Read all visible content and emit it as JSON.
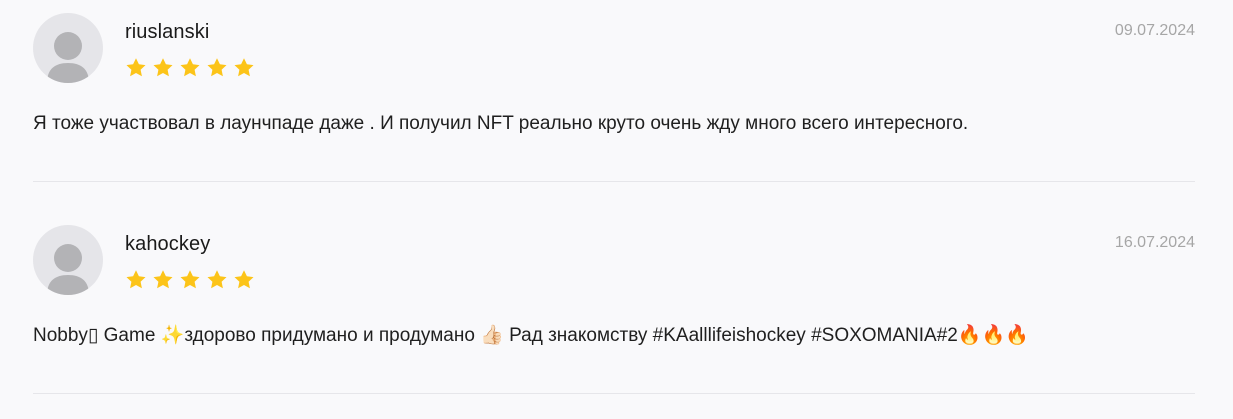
{
  "reviews": [
    {
      "username": "riuslanski",
      "rating": 5,
      "date": "09.07.2024",
      "text": "Я тоже участвовал в лаунчпаде даже . И получил NFT реально круто очень жду много всего интересного."
    },
    {
      "username": "kahockey",
      "rating": 5,
      "date": "16.07.2024",
      "text": "Nobby▯ Game ✨здорово придумано и продумано 👍🏻 Рад знакомству #KAalllifeishockey #SOXOMANIA#2🔥🔥🔥"
    }
  ],
  "colors": {
    "star": "#fcc419",
    "avatar_bg": "#e5e5e9",
    "avatar_figure": "#b3b3b6",
    "date": "#a6a6a6",
    "divider": "#e6e6ea",
    "background": "#f9f9fb"
  },
  "icons": {
    "avatar": "user-silhouette-icon",
    "star": "star-icon"
  }
}
